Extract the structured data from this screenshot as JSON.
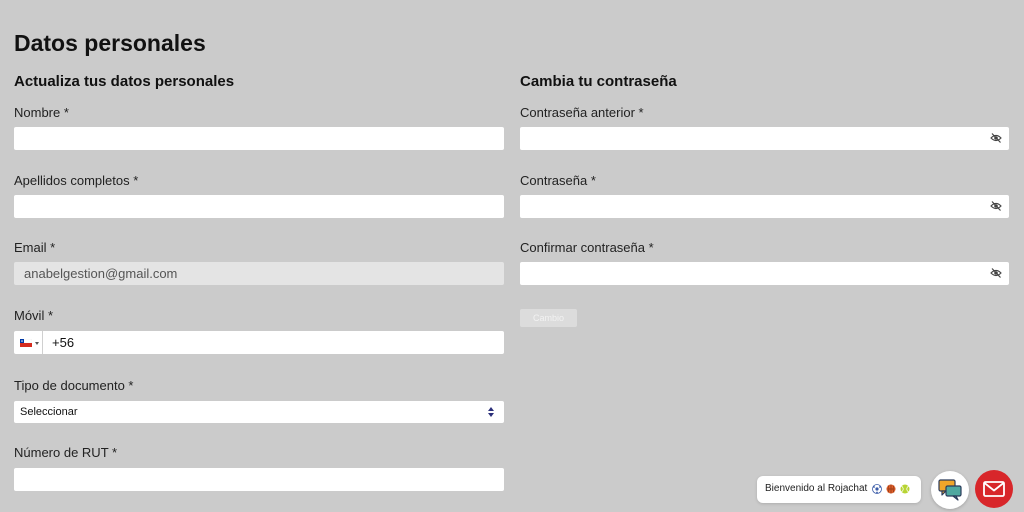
{
  "page": {
    "title": "Datos personales"
  },
  "personal": {
    "section_title": "Actualiza tus datos personales",
    "nombre_label": "Nombre *",
    "nombre_value": "",
    "apellidos_label": "Apellidos completos *",
    "apellidos_value": "",
    "email_label": "Email *",
    "email_value": "anabelgestion@gmail.com",
    "movil_label": "Móvil *",
    "movil_value": "+56",
    "tipo_doc_label": "Tipo de documento *",
    "tipo_doc_value": "Seleccionar",
    "rut_label": "Número de RUT *",
    "rut_value": ""
  },
  "password": {
    "section_title": "Cambia tu contraseña",
    "old_label": "Contraseña anterior *",
    "new_label": "Contraseña *",
    "confirm_label": "Confirmar contraseña *",
    "submit_label": "Cambio"
  },
  "chat": {
    "greeting": "Bienvenido al Rojachat"
  },
  "icons": {
    "eye": "eye-slash-icon",
    "flag": "chile-flag-icon",
    "select": "select-arrows-icon",
    "chat": "chat-bubbles-icon",
    "mail": "mail-icon",
    "sports": [
      "soccer-ball-icon",
      "basketball-icon",
      "tennis-ball-icon"
    ]
  },
  "colors": {
    "background": "#cbcbcb",
    "input_bg": "#ffffff",
    "input_disabled_bg": "#e4e4e4",
    "mail_button": "#d8262a"
  }
}
